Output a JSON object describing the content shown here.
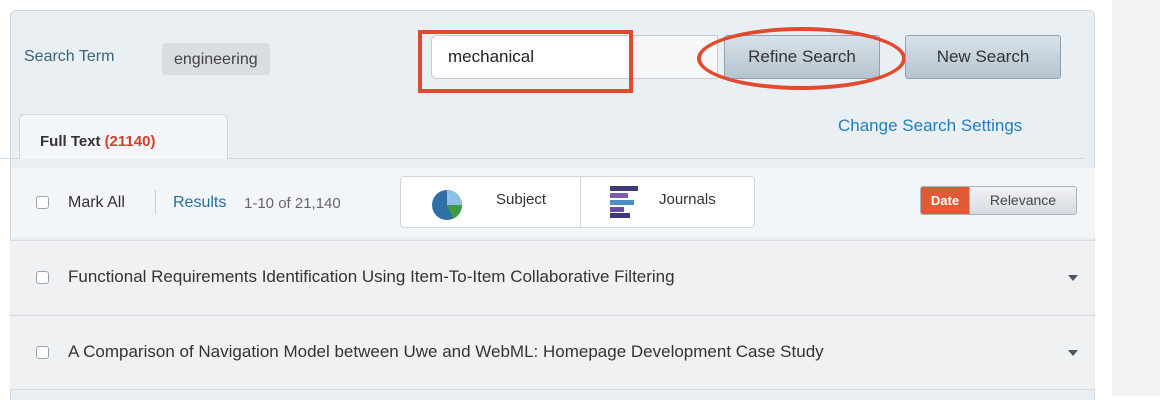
{
  "search": {
    "term_label": "Search Term",
    "term_value": "engineering",
    "refine_input_value": "mechanical",
    "refine_button_label": "Refine Search",
    "new_button_label": "New Search"
  },
  "tabs": [
    {
      "label": "Full Text",
      "count": "(21140)",
      "active": true
    }
  ],
  "change_settings_label": "Change Search Settings",
  "toolbar": {
    "mark_all_label": "Mark All",
    "results_label": "Results",
    "results_range": "1-10 of 21,140",
    "facets": [
      {
        "label": "Subject",
        "icon": "pie-chart-icon"
      },
      {
        "label": "Journals",
        "icon": "journal-stack-icon"
      }
    ],
    "sort_options": [
      "Date",
      "Relevance"
    ],
    "sort_selected": "Date"
  },
  "results": [
    {
      "title": "Functional Requirements Identification Using Item-To-Item Collaborative Filtering"
    },
    {
      "title": "A Comparison of Navigation Model between Uwe and WebML: Homepage Development Case Study"
    }
  ],
  "colors": {
    "annotation_red": "#e24a2e",
    "link_blue": "#1f7fc0",
    "count_red": "#d0402d",
    "sort_active": "#e05a36"
  }
}
